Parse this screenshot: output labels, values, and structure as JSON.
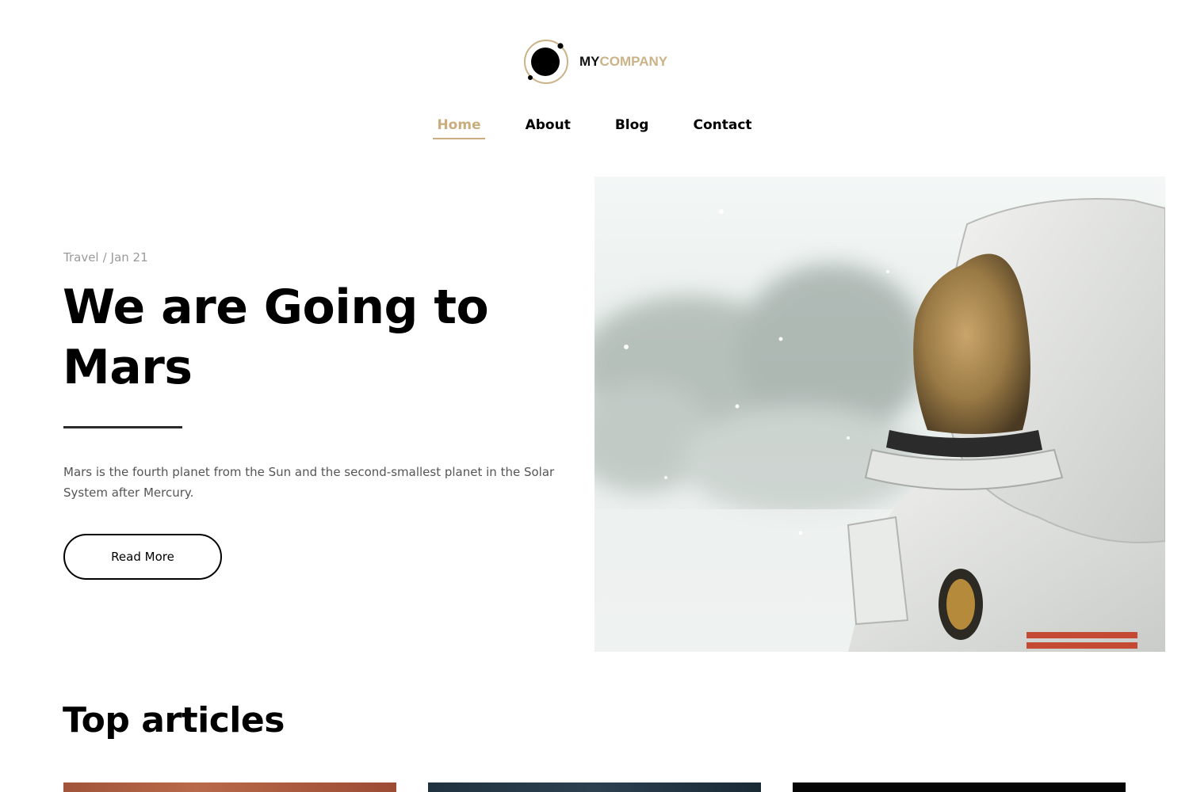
{
  "brand": {
    "name_part1": "MY",
    "name_part2": "COMPANY",
    "logo_icon": "planet-orbit-icon",
    "colors": {
      "accent": "#c9ad7e",
      "dark": "#111111"
    }
  },
  "nav": {
    "items": [
      {
        "label": "Home",
        "active": true
      },
      {
        "label": "About",
        "active": false
      },
      {
        "label": "Blog",
        "active": false
      },
      {
        "label": "Contact",
        "active": false
      }
    ]
  },
  "hero": {
    "category": "Travel",
    "separator": "/",
    "date": "Jan 21",
    "title": "We are Going to Mars",
    "description": "Mars is the fourth planet from the Sun and the second-smallest planet in the Solar System after Mercury.",
    "button_label": "Read More",
    "image": "astronaut-helmet-snow-photo"
  },
  "top_articles": {
    "title": "Top articles",
    "cards": [
      {
        "image": "mars-surface-photo"
      },
      {
        "image": "night-sky-photo"
      },
      {
        "image": "dark-space-photo"
      }
    ]
  }
}
